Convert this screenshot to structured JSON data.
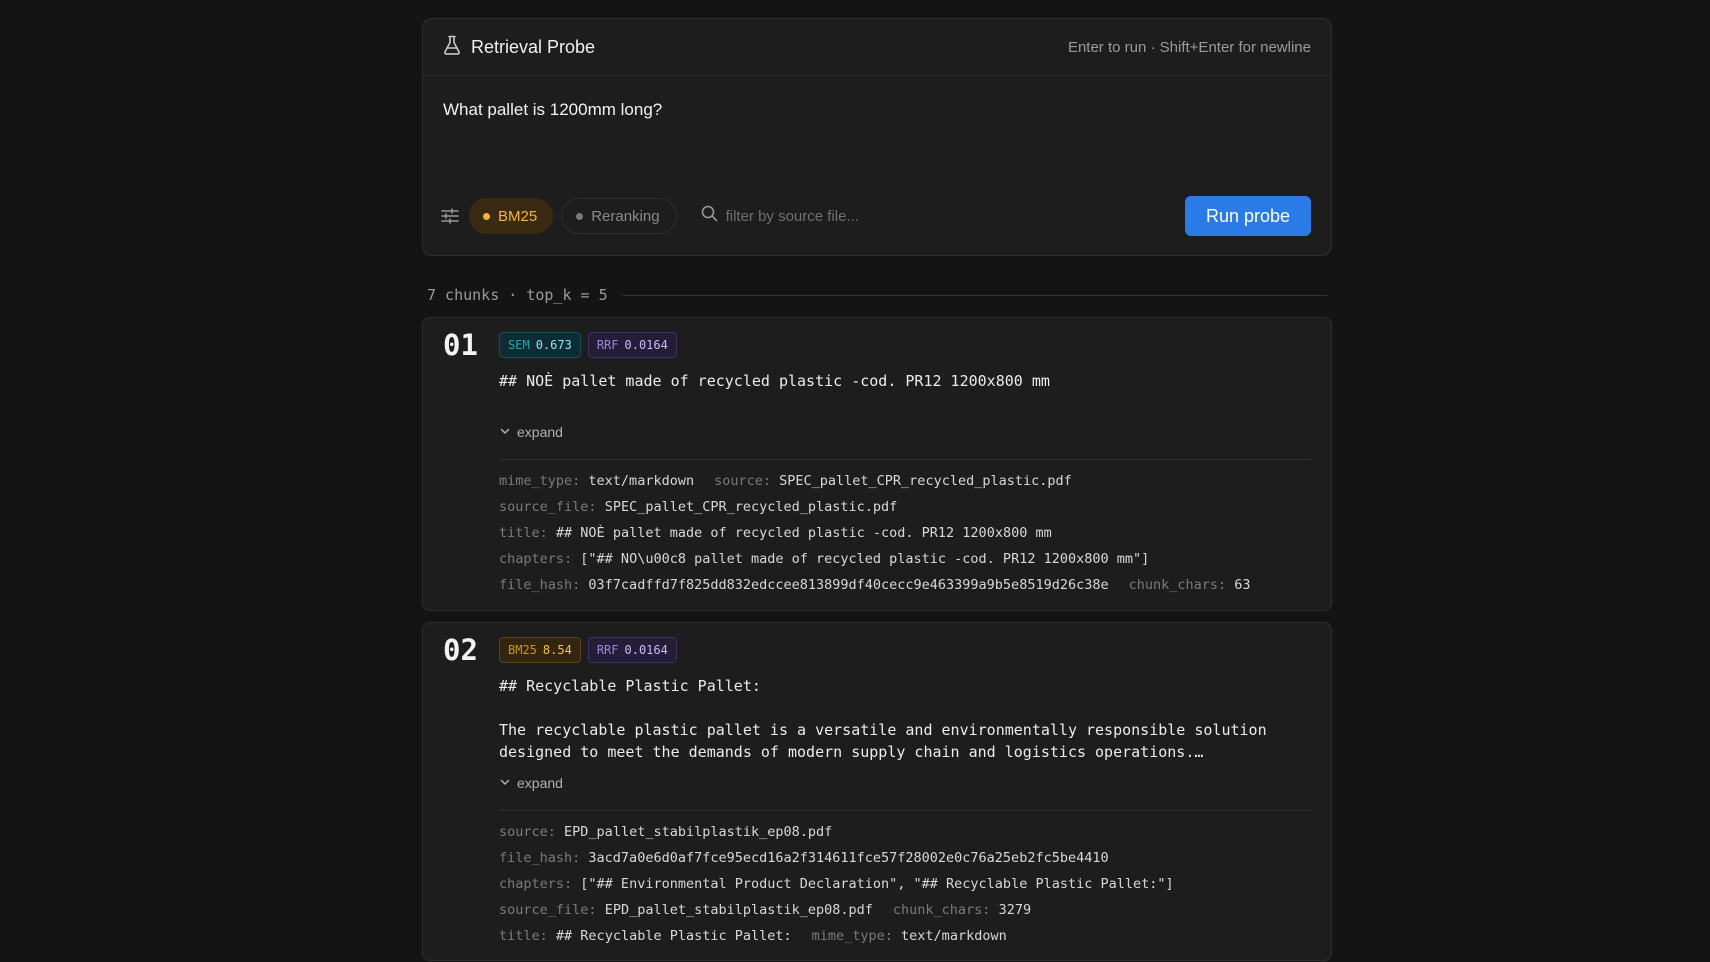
{
  "probe": {
    "title": "Retrieval Probe",
    "hint": "Enter to run · Shift+Enter for newline",
    "query": "What pallet is 1200mm long?",
    "chips": {
      "bm25": "BM25",
      "reranking": "Reranking"
    },
    "filter_placeholder": "filter by source file...",
    "run_label": "Run probe"
  },
  "summary": {
    "text": "7 chunks · top_k = 5"
  },
  "results": [
    {
      "rank": "01",
      "badges": [
        {
          "label": "SEM",
          "value": "0.673"
        },
        {
          "label": "RRF",
          "value": "0.0164"
        }
      ],
      "text": "## NOÈ pallet made of recycled plastic -cod. PR12 1200x800 mm",
      "expand_label": "expand",
      "meta": {
        "mime_type_key": "mime_type:",
        "mime_type": "text/markdown",
        "source_key": "source:",
        "source": "SPEC_pallet_CPR_recycled_plastic.pdf",
        "source_file_key": "source_file:",
        "source_file": "SPEC_pallet_CPR_recycled_plastic.pdf",
        "title_key": "title:",
        "title": "## NOÈ pallet made of recycled plastic -cod. PR12 1200x800 mm",
        "chapters_key": "chapters:",
        "chapters": "[\"## NO\\u00c8 pallet made of recycled plastic -cod. PR12 1200x800 mm\"]",
        "file_hash_key": "file_hash:",
        "file_hash": "03f7cadffd7f825dd832edccee813899df40cecc9e463399a9b5e8519d26c38e",
        "chunk_chars_key": "chunk_chars:",
        "chunk_chars": "63"
      }
    },
    {
      "rank": "02",
      "badges": [
        {
          "label": "BM25",
          "value": "8.54"
        },
        {
          "label": "RRF",
          "value": "0.0164"
        }
      ],
      "text": "## Recyclable Plastic Pallet:\n\nThe recyclable plastic pallet is a versatile and environmentally responsible solution\ndesigned to meet the demands of modern supply chain and logistics operations.…",
      "expand_label": "expand",
      "meta": {
        "source_key": "source:",
        "source": "EPD_pallet_stabilplastik_ep08.pdf",
        "file_hash_key": "file_hash:",
        "file_hash": "3acd7a0e6d0af7fce95ecd16a2f314611fce57f28002e0c76a25eb2fc5be4410",
        "chapters_key": "chapters:",
        "chapters": "[\"## Environmental Product Declaration\", \"## Recyclable Plastic Pallet:\"]",
        "source_file_key": "source_file:",
        "source_file": "EPD_pallet_stabilplastik_ep08.pdf",
        "chunk_chars_key": "chunk_chars:",
        "chunk_chars": "3279",
        "title_key": "title:",
        "title": "## Recyclable Plastic Pallet:",
        "mime_type_key": "mime_type:",
        "mime_type": "text/markdown"
      }
    }
  ],
  "colors": {
    "accent": "#2b7be6",
    "bm25": "#f1b53a",
    "sem": "#3fb8d1",
    "rrf": "#9a86d8"
  },
  "icons": [
    "flask-icon",
    "sliders-icon",
    "search-icon",
    "chevron-down-icon"
  ]
}
